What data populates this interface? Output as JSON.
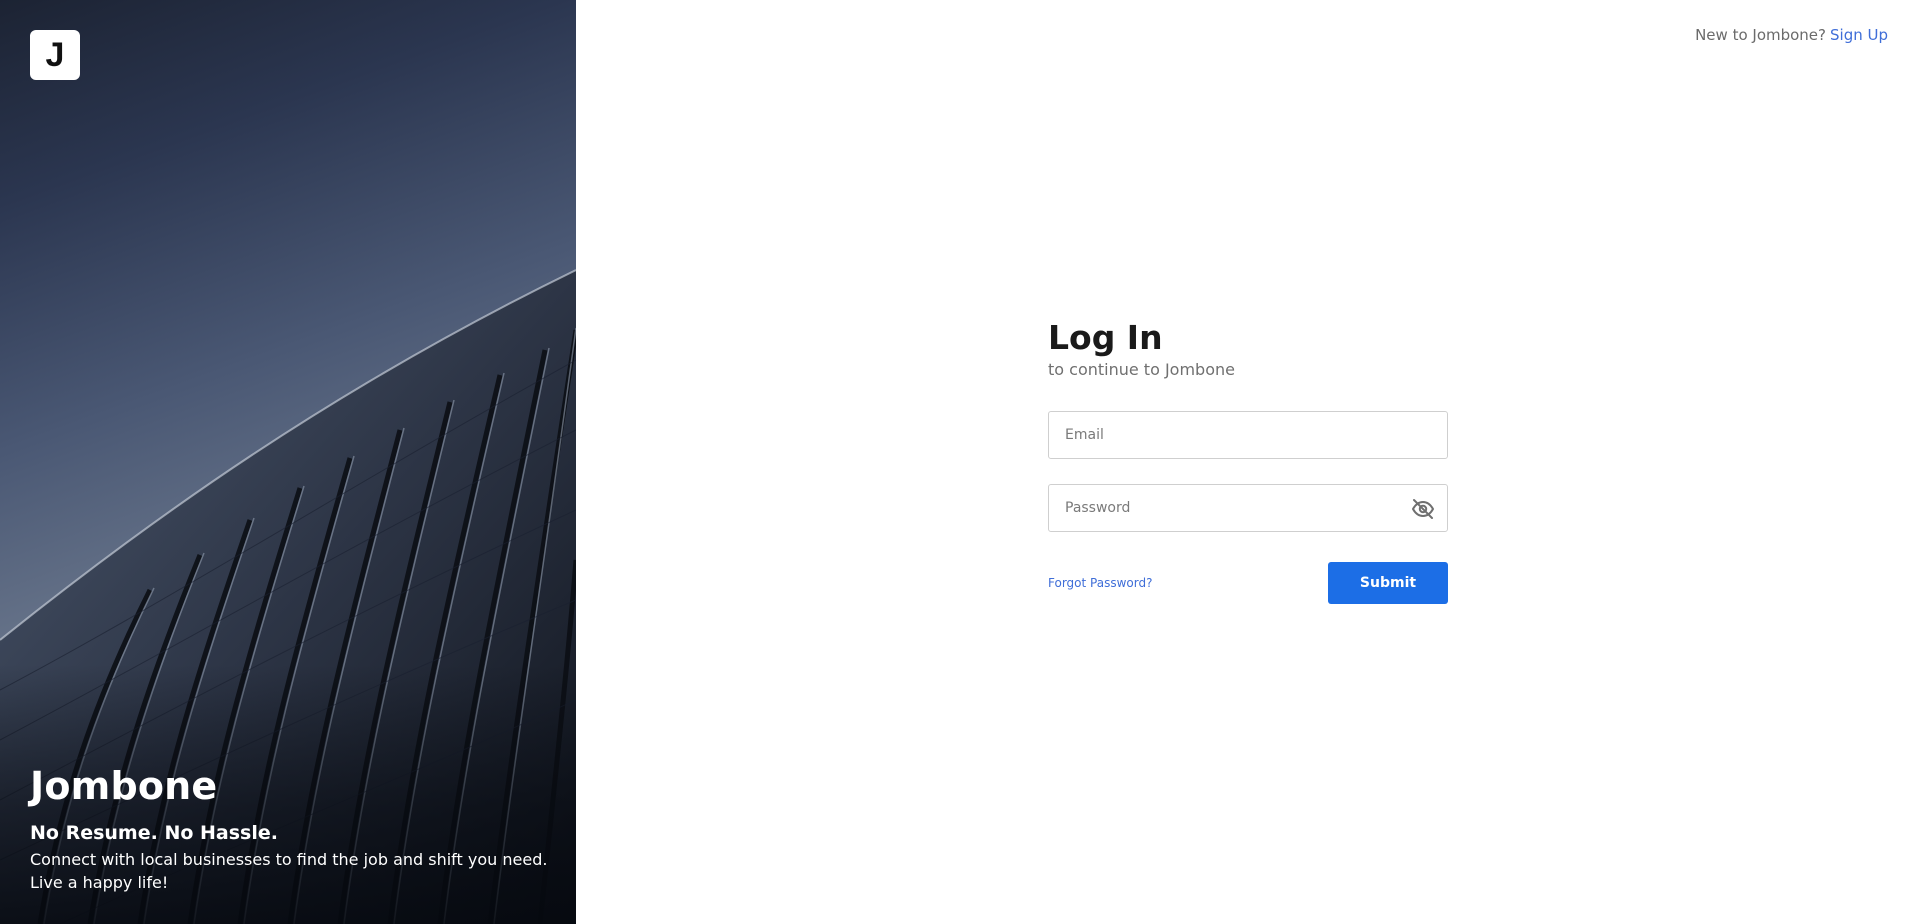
{
  "brand": {
    "logo_letter": "J",
    "name": "Jombone",
    "tagline": "No Resume. No Hassle.",
    "description": "Connect with local businesses to find the job and shift you need. Live a happy life!"
  },
  "header": {
    "signup_prompt": "New to Jombone?",
    "signup_link": "Sign Up"
  },
  "login": {
    "title": "Log In",
    "subtitle": "to continue to Jombone",
    "email_placeholder": "Email",
    "password_placeholder": "Password",
    "password_toggle_icon": "eye-off-icon",
    "forgot_link": "Forgot Password?",
    "submit_label": "Submit"
  },
  "colors": {
    "accent": "#1c6ee6",
    "link": "#3f6ed8"
  }
}
